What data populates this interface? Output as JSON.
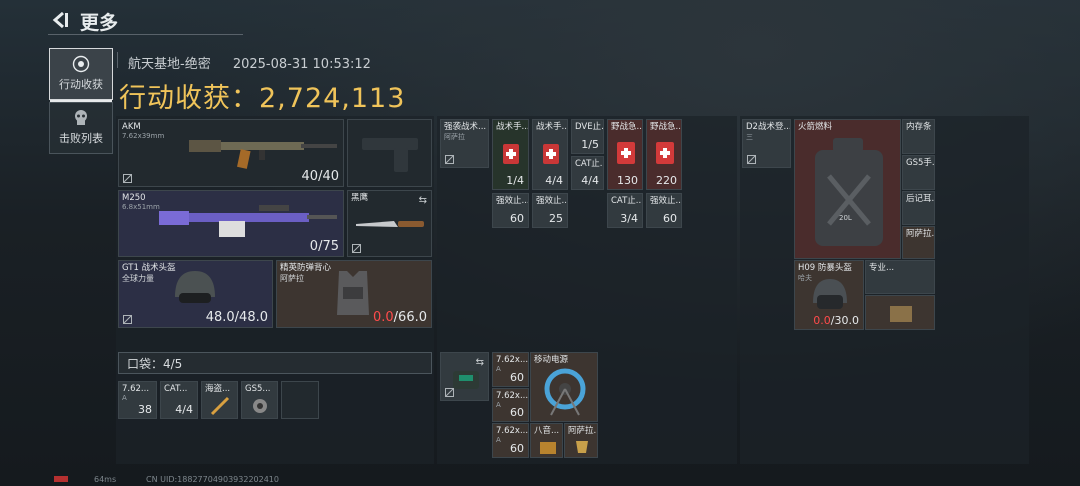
{
  "header": {
    "back_icon": "back-arrow-icon",
    "title": "更多"
  },
  "nav": [
    {
      "label": "行动收获",
      "icon": "loot-bag-icon",
      "active": true
    },
    {
      "label": "击败列表",
      "icon": "skull-icon",
      "active": false
    }
  ],
  "info": {
    "map": "航天基地-绝密",
    "timestamp": "2025-08-31 10:53:12"
  },
  "total": {
    "label": "行动收获：",
    "value": "2,724,113"
  },
  "equipment": {
    "primary": {
      "name": "AKM",
      "caliber": "7.62x39mm",
      "ammo": "40/40"
    },
    "secondary_slot": "pistol-silhouette",
    "primary2": {
      "name": "M250",
      "caliber": "6.8x51mm",
      "ammo": "0/75"
    },
    "melee": {
      "name": "黑鹰"
    },
    "helmet": {
      "name": "GT1 战术头盔",
      "brand": "全球力量",
      "durability": "48.0/48.0"
    },
    "armor": {
      "name": "精英防弹背心",
      "brand": "阿萨拉",
      "durability_cur": "0.0",
      "durability_max": "/66.0"
    }
  },
  "pocket": {
    "label": "口袋：4/5",
    "items": [
      {
        "name": "7.62...",
        "sub": "A",
        "count": "38"
      },
      {
        "name": "CAT...",
        "count": "4/4"
      },
      {
        "name": "海盗...",
        "count": ""
      },
      {
        "name": "GS5...",
        "count": ""
      },
      {
        "name": "",
        "count": ""
      }
    ]
  },
  "rig": {
    "items": [
      {
        "name": "强袭战术...",
        "sub": "阿萨拉"
      },
      {
        "name": "战术手...",
        "count": "1/4"
      },
      {
        "name": "战术手...",
        "count": "4/4"
      },
      {
        "name": "DVE止...",
        "count": "1/5"
      },
      {
        "name": "野战急...",
        "count": "130"
      },
      {
        "name": "野战急...",
        "count": "220"
      },
      {
        "name": "CAT止...",
        "count": "4/4"
      },
      {
        "name": "强效止...",
        "count": "60"
      },
      {
        "name": "强效止...",
        "count": "25"
      },
      {
        "name": "CAT止...",
        "count": "3/4"
      },
      {
        "name": "强效止...",
        "count": "60"
      }
    ]
  },
  "backpack": {
    "items": [
      {
        "name": "7.62x...",
        "sub": "A",
        "count": "60"
      },
      {
        "name": "移动电源",
        "count": ""
      },
      {
        "name": "7.62x...",
        "sub": "A",
        "count": "60"
      },
      {
        "name": "7.62x...",
        "sub": "A",
        "count": "60"
      },
      {
        "name": "八音...",
        "count": ""
      },
      {
        "name": "阿萨拉...",
        "count": ""
      }
    ]
  },
  "safe": {
    "items": [
      {
        "name": "D2战术登...",
        "sub": "三"
      },
      {
        "name": "火箭燃料",
        "label": "20L"
      },
      {
        "name": "内存条",
        "count": ""
      },
      {
        "name": "GS5手...",
        "count": ""
      },
      {
        "name": "后记耳...",
        "count": ""
      },
      {
        "name": "阿萨拉...",
        "count": ""
      },
      {
        "name": "H09 防暴头盔",
        "sub": "哈夫",
        "durability_cur": "0.0",
        "durability_max": "/30.0"
      },
      {
        "name": "专业...",
        "count": ""
      },
      {
        "name": "",
        "count": ""
      }
    ]
  },
  "footer": {
    "ping": "64ms",
    "uid": "CN UID:18827704903932202410"
  },
  "colors": {
    "gold": "#f0c45a",
    "accent_red": "#ff4b4b"
  }
}
